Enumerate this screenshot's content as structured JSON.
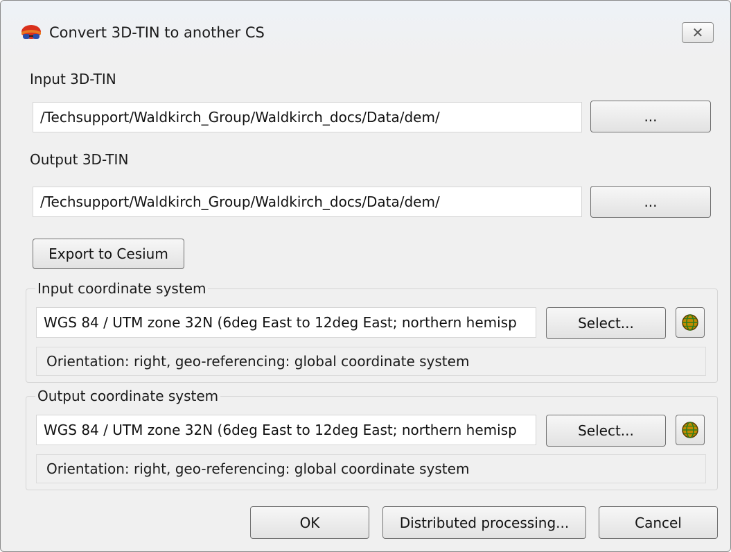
{
  "window": {
    "title": "Convert 3D-TIN to another CS",
    "close_symbol": "✕"
  },
  "input_tin": {
    "label": "Input 3D-TIN",
    "path": "/Techsupport/Waldkirch_Group/Waldkirch_docs/Data/dem/",
    "browse_label": "..."
  },
  "output_tin": {
    "label": "Output 3D-TIN",
    "path": "/Techsupport/Waldkirch_Group/Waldkirch_docs/Data/dem/",
    "browse_label": "..."
  },
  "export_button": "Export to Cesium",
  "input_cs": {
    "title": "Input coordinate system",
    "value": "WGS 84 / UTM zone 32N (6deg East to 12deg East; northern hemisp",
    "select_label": "Select...",
    "info": "Orientation: right, geo-referencing: global coordinate system",
    "icon": "globe-icon"
  },
  "output_cs": {
    "title": "Output coordinate system",
    "value": "WGS 84 / UTM zone 32N (6deg East to 12deg East; northern hemisp",
    "select_label": "Select...",
    "info": "Orientation: right, geo-referencing: global coordinate system",
    "icon": "globe-icon"
  },
  "footer": {
    "ok": "OK",
    "distributed": "Distributed processing...",
    "cancel": "Cancel"
  },
  "colors": {
    "globe": "#c28a00",
    "globe_grid": "#2e7d1a",
    "app_icon_red": "#d9301c",
    "app_icon_blue": "#2a4ea8"
  }
}
